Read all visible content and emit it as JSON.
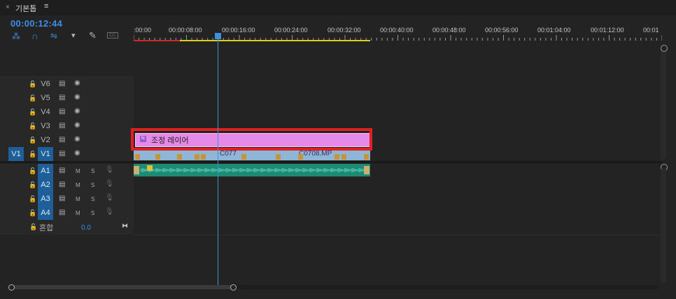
{
  "tab": {
    "close": "×",
    "title": "기본톱",
    "menu": "≡"
  },
  "timecode": "00:00:12:44",
  "toolbar": [
    "⁂",
    "∩",
    "⇋",
    "▾",
    "✎",
    "CC"
  ],
  "ruler": {
    "labels": [
      ":00:00",
      "00:00:08:00",
      "00:00:16:00",
      "00:00:24:00",
      "00:00:32:00",
      "00:00:40:00",
      "00:00:48:00",
      "00:00:56:00",
      "00:01:04:00",
      "00:01:12:00",
      "00:01"
    ]
  },
  "video_tracks": [
    {
      "name": "V6",
      "selected": false,
      "source": ""
    },
    {
      "name": "V5",
      "selected": false,
      "source": ""
    },
    {
      "name": "V4",
      "selected": false,
      "source": ""
    },
    {
      "name": "V3",
      "selected": false,
      "source": ""
    },
    {
      "name": "V2",
      "selected": false,
      "source": ""
    },
    {
      "name": "V1",
      "selected": true,
      "source": "V1"
    }
  ],
  "audio_tracks": [
    {
      "name": "A1",
      "m": "M",
      "s": "S"
    },
    {
      "name": "A2",
      "m": "M",
      "s": "S"
    },
    {
      "name": "A3",
      "m": "M",
      "s": "S"
    },
    {
      "name": "A4",
      "m": "M",
      "s": "S"
    }
  ],
  "mix": {
    "label": "혼합",
    "value": "0.0"
  },
  "clips": {
    "adjustment_layer": {
      "fx": "fx",
      "label": "조정 레이어"
    },
    "v1_a": "C077",
    "v1_b": "C0708.MP"
  },
  "colors": {
    "accent": "#3f8fdc",
    "adjustment": "#e78ae7",
    "highlight": "#e02020",
    "audio": "#1c8a74",
    "video": "#8fb6d6"
  }
}
